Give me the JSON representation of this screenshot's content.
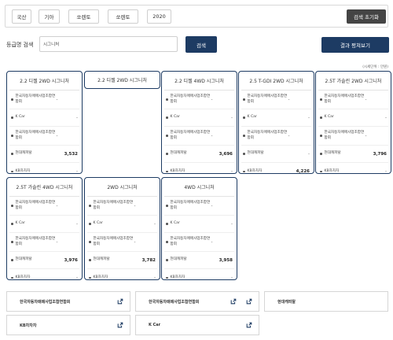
{
  "filters": {
    "chips": [
      "국산",
      "기아",
      "쏘렌토",
      "쏘렌토",
      "2020"
    ],
    "reset_label": "검색 초기화"
  },
  "search": {
    "label": "등급명 검색",
    "value": "시그니처",
    "button_label": "검색",
    "avg_button_label": "결과 평쳐보기"
  },
  "unit_note": "(시세단위 : 만원)",
  "cards": [
    {
      "title": "2.2 디젤 2WD 시그니처",
      "rows": [
        {
          "name": "한국자동차매매사업조합연합회",
          "value": "-"
        },
        {
          "name": "K Car",
          "value": "-"
        },
        {
          "name": "한국자동차매매사업조합연합회",
          "value": "-"
        },
        {
          "name": "현대캐피탈",
          "value": "3,532"
        },
        {
          "name": "KB차차차",
          "value": "-"
        }
      ]
    },
    {
      "title": "2.2 디젤 2WD 시그니처",
      "rows": []
    },
    {
      "title": "2.2 디젤 4WD 시그니처",
      "rows": [
        {
          "name": "한국자동차매매사업조합연합회",
          "value": "-"
        },
        {
          "name": "K Car",
          "value": "-"
        },
        {
          "name": "한국자동차매매사업조합연합회",
          "value": "-"
        },
        {
          "name": "현대캐피탈",
          "value": "3,696"
        },
        {
          "name": "KB차차차",
          "value": "-"
        }
      ]
    },
    {
      "title": "2.5 T-GDI 2WD 시그니처",
      "rows": [
        {
          "name": "한국자동차매매사업조합연합회",
          "value": "-"
        },
        {
          "name": "K Car",
          "value": "-"
        },
        {
          "name": "한국자동차매매사업조합연합회",
          "value": "-"
        },
        {
          "name": "현대캐피탈",
          "value": "-"
        },
        {
          "name": "KB차차차",
          "value": "4,226"
        }
      ]
    },
    {
      "title": "2.5T 가솔린 2WD 시그니처",
      "rows": [
        {
          "name": "한국자동차매매사업조합연합회",
          "value": "-"
        },
        {
          "name": "K Car",
          "value": "-"
        },
        {
          "name": "한국자동차매매사업조합연합회",
          "value": "-"
        },
        {
          "name": "현대캐피탈",
          "value": "3,796"
        },
        {
          "name": "KB차차차",
          "value": "-"
        }
      ]
    },
    {
      "title": "2.5T 가솔린 4WD 시그니처",
      "rows": [
        {
          "name": "한국자동차매매사업조합연합회",
          "value": "-"
        },
        {
          "name": "K Car",
          "value": "-"
        },
        {
          "name": "한국자동차매매사업조합연합회",
          "value": "-"
        },
        {
          "name": "현대캐피탈",
          "value": "3,976"
        },
        {
          "name": "KB차차차",
          "value": "-"
        }
      ]
    },
    {
      "title": "2WD 시그니처",
      "rows": [
        {
          "name": "한국자동차매매사업조합연합회",
          "value": "-"
        },
        {
          "name": "K Car",
          "value": "-"
        },
        {
          "name": "한국자동차매매사업조합연합회",
          "value": "-"
        },
        {
          "name": "현대캐피탈",
          "value": "3,782"
        },
        {
          "name": "KB차차차",
          "value": "-"
        }
      ]
    },
    {
      "title": "4WD 시그니처",
      "rows": [
        {
          "name": "한국자동차매매사업조합연합회",
          "value": "-"
        },
        {
          "name": "K Car",
          "value": "-"
        },
        {
          "name": "한국자동차매매사업조합연합회",
          "value": "-"
        },
        {
          "name": "현대캐피탈",
          "value": "3,958"
        },
        {
          "name": "KB차차차",
          "value": "-"
        }
      ]
    }
  ],
  "links": [
    {
      "label": "한국자동차매매사업조합연합회",
      "icon": "external-link-icon"
    },
    {
      "label": "한국자동차매매사업조합연합회",
      "icon": "external-link-icon"
    },
    {
      "label": "현대캐피탈",
      "icon": "external-link-icon"
    },
    {
      "label": "KB차차차",
      "icon": "external-link-icon"
    },
    {
      "label": "K Car",
      "icon": "external-link-icon"
    }
  ],
  "colors": {
    "navy": "#1d3b63",
    "dark_button": "#444444"
  }
}
